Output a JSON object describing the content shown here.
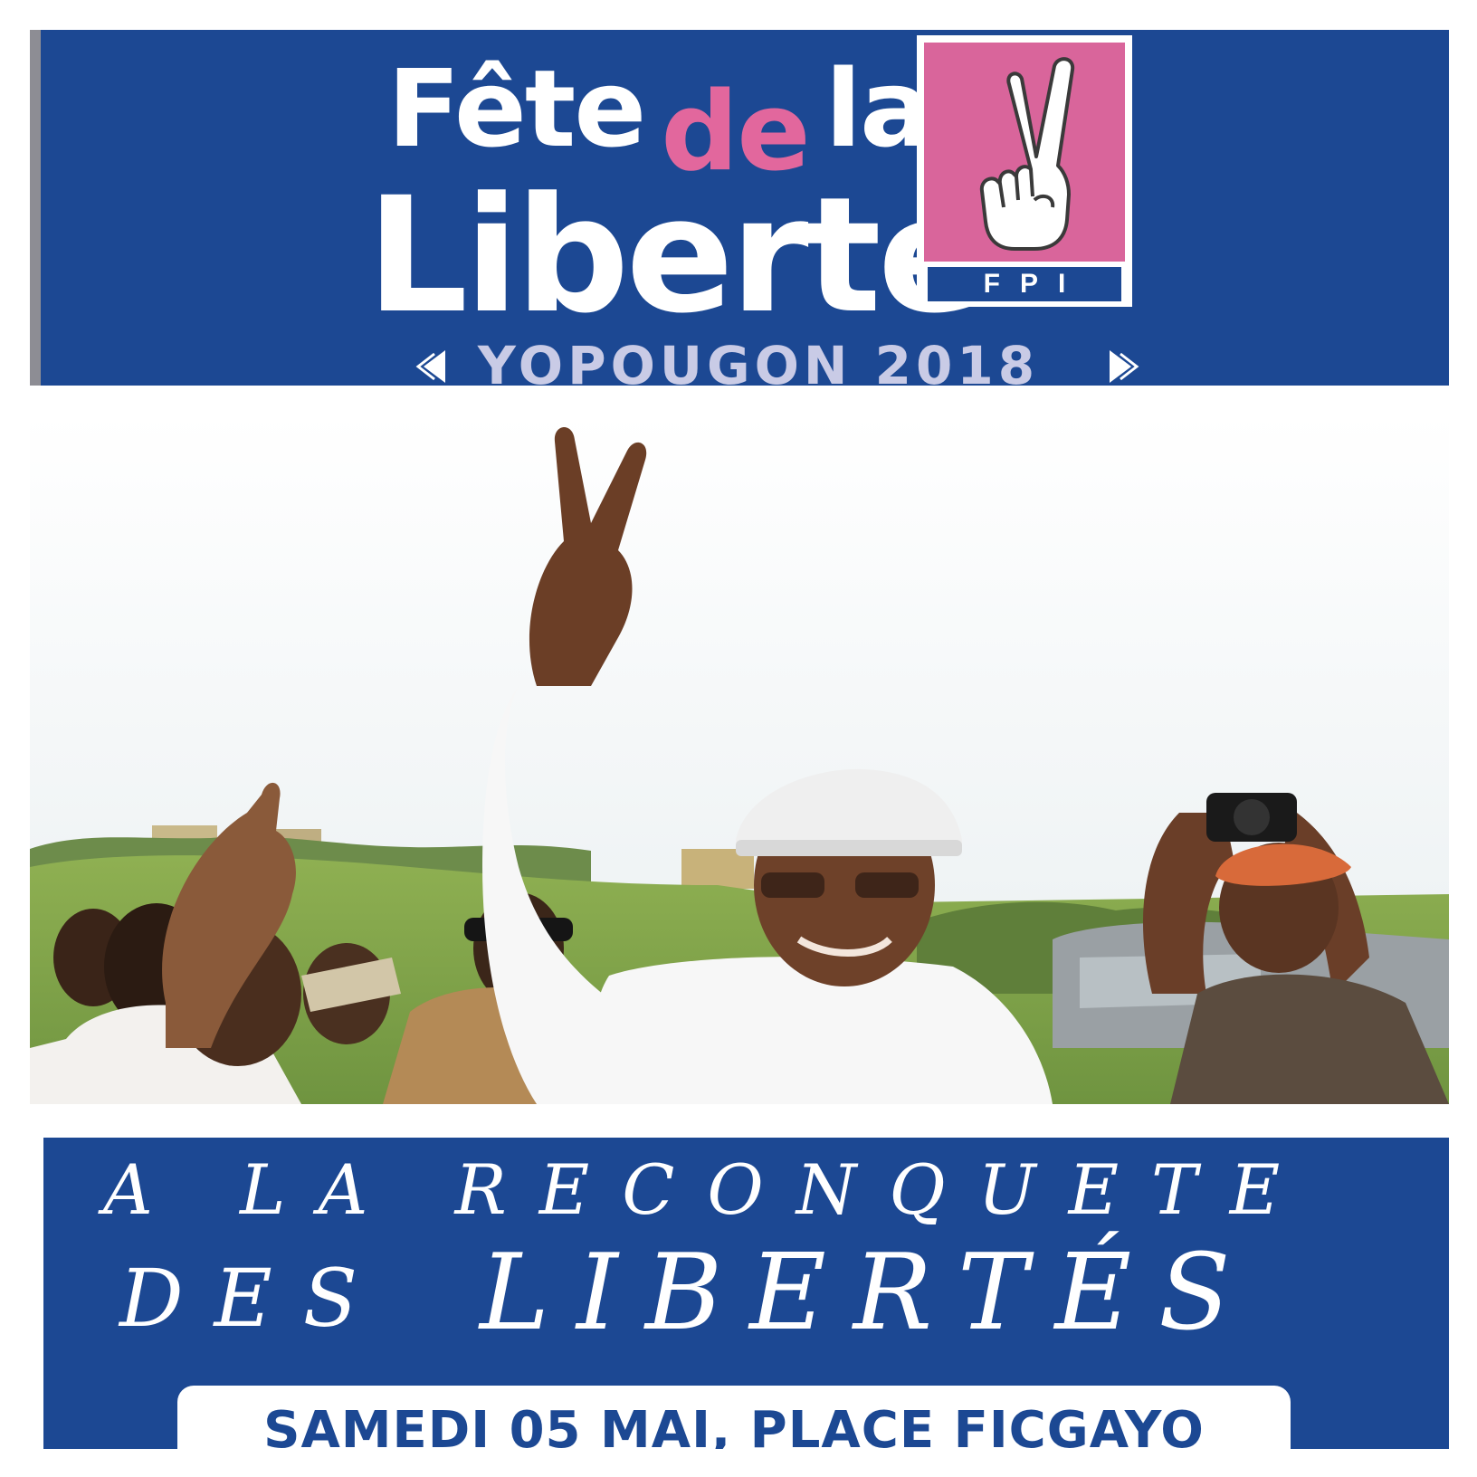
{
  "header": {
    "title_part1": "Fête",
    "title_part2": "de",
    "title_part3": "la",
    "title_line2": "Liberté",
    "location_year": "YOPOUGON 2018",
    "logo_text": "FPI"
  },
  "photo": {
    "description_icon": "photo-icon"
  },
  "slogan": {
    "line1": "A LA RECONQUETE",
    "line2_a": "DES",
    "line2_b": "LIBERTÉS"
  },
  "event": {
    "date_place": "SAMEDI 05 MAI, PLACE FICGAYO"
  },
  "colors": {
    "banner_blue": "#1c4893",
    "logo_pink": "#d9659b",
    "accent_pink": "#e2679d",
    "lavender_text": "#c9cbe6"
  }
}
